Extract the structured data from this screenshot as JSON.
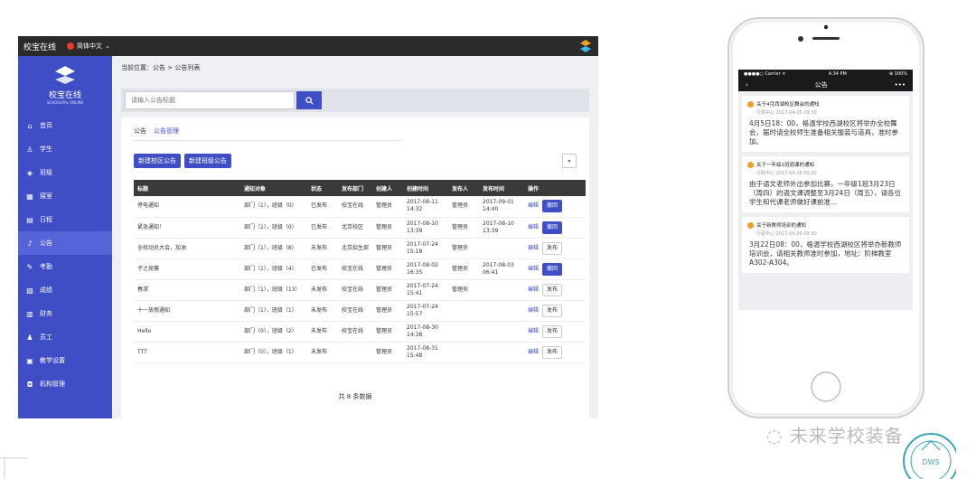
{
  "app": {
    "brand": "校宝在线",
    "language": "简体中文",
    "logo_title": "校宝在线",
    "logo_subtitle": "SCHOOLPAL ONLINE"
  },
  "sidebar": {
    "items": [
      {
        "label": "首页",
        "icon": "home-icon",
        "glyph": "⌂"
      },
      {
        "label": "学生",
        "icon": "student-icon",
        "glyph": "♙"
      },
      {
        "label": "班级",
        "icon": "class-icon",
        "glyph": "◈"
      },
      {
        "label": "寝室",
        "icon": "dorm-icon",
        "glyph": "▦"
      },
      {
        "label": "日程",
        "icon": "calendar-icon",
        "glyph": "▤"
      },
      {
        "label": "公告",
        "icon": "bell-icon",
        "glyph": "♪"
      },
      {
        "label": "考勤",
        "icon": "attendance-icon",
        "glyph": "✎"
      },
      {
        "label": "成绩",
        "icon": "score-icon",
        "glyph": "▧"
      },
      {
        "label": "财务",
        "icon": "finance-icon",
        "glyph": "▥"
      },
      {
        "label": "员工",
        "icon": "staff-icon",
        "glyph": "♟"
      },
      {
        "label": "教学设置",
        "icon": "settings-icon",
        "glyph": "▣"
      },
      {
        "label": "机构管理",
        "icon": "org-icon",
        "glyph": "◘"
      }
    ]
  },
  "breadcrumb": "当前位置：公告 > 公告列表",
  "search": {
    "placeholder": "请输入公告标题"
  },
  "tabs": [
    "公告",
    "公告管理"
  ],
  "actions": {
    "new_school": "新建校区公告",
    "new_class": "新建班级公告"
  },
  "table": {
    "headers": [
      "标题",
      "通知对象",
      "状态",
      "发布部门",
      "创建人",
      "创建时间",
      "发布人",
      "发布时间",
      "操作"
    ],
    "rows": [
      {
        "title": "停电通知",
        "target": "部门（1），班级（0）",
        "status": "已发布",
        "dept": "校宝在线",
        "creator": "管理员",
        "created": "2017-08-11 14:32",
        "publisher": "管理员",
        "published": "2017-09-01 14:40",
        "edit": "编辑",
        "action": "撤回"
      },
      {
        "title": "紧急通知！",
        "target": "部门（1），班级（0）",
        "status": "已发布",
        "dept": "北京校区",
        "creator": "管理员",
        "created": "2017-08-10 13:39",
        "publisher": "管理员",
        "published": "2017-08-10 13:39",
        "edit": "编辑",
        "action": "撤回"
      },
      {
        "title": "全校动员大会，加油",
        "target": "部门（1），班级（8）",
        "status": "未发布",
        "dept": "北京招生部",
        "creator": "管理员",
        "created": "2017-07-24 15:18",
        "publisher": "管理员",
        "published": "",
        "edit": "编辑",
        "action": "发布"
      },
      {
        "title": "子之竞赛",
        "target": "部门（1），班级（4）",
        "status": "已发布",
        "dept": "校宝在线",
        "creator": "管理员",
        "created": "2017-08-02 16:35",
        "publisher": "管理员",
        "published": "2017-08-03 06:41",
        "edit": "编辑",
        "action": "撤回"
      },
      {
        "title": "春游",
        "target": "部门（1），班级（13）",
        "status": "未发布",
        "dept": "校宝在线",
        "creator": "管理员",
        "created": "2017-07-24 15:41",
        "publisher": "管理员",
        "published": "",
        "edit": "编辑",
        "action": "发布"
      },
      {
        "title": "十一放假通知",
        "target": "部门（1），班级（1）",
        "status": "未发布",
        "dept": "校宝在线",
        "creator": "管理员",
        "created": "2017-07-24 15:57",
        "publisher": "",
        "published": "",
        "edit": "编辑",
        "action": "发布"
      },
      {
        "title": "Hello",
        "target": "部门（0），班级（2）",
        "status": "未发布",
        "dept": "校宝在线",
        "creator": "管理员",
        "created": "2017-08-30 14:38",
        "publisher": "",
        "published": "",
        "edit": "编辑",
        "action": "发布"
      },
      {
        "title": "TTT",
        "target": "部门（0），班级（1）",
        "status": "未发布",
        "dept": "",
        "creator": "管理员",
        "created": "2017-08-31 15:48",
        "publisher": "",
        "published": "",
        "edit": "编辑",
        "action": "发布"
      }
    ],
    "total": "共 8 条数据"
  },
  "phone": {
    "carrier": "●●●●○ Carrier ᯤ",
    "time": "4:34 PM",
    "battery": "⊕ 100%",
    "title": "公告",
    "back": "‹",
    "more": "•••",
    "cards": [
      {
        "title": "关于4月西湖校区舞会的通知",
        "meta": "行政中心  2017-04-26 09:30",
        "body": "4月5日18：00，格温学校西湖校区将举办全校舞会，届时请全校师生准备相关服装与道具，准时参加。"
      },
      {
        "title": "关于一年级1班调课的通知",
        "meta": "行政中心  2017-04-26 09:30",
        "body": "由于语文老师外出参加比赛，一年级1班3月23日（周四）的语文课调整至3月24日（周五），请各位学生和代课老师做好课前准..."
      },
      {
        "title": "关于新教师培训的通知",
        "meta": "行政中心  2017-04-26 09:30",
        "body": "3月22日08：00，格温学校西湖校区将举办新教师培训会，请相关教师准时参加，地址：阶梯教室A302-A304。"
      }
    ]
  },
  "watermark": {
    "text": "未来学校装备",
    "seal_text": "DWS"
  },
  "colors": {
    "accent": "#3f4ec4",
    "topbar": "#2b2b2b",
    "card_dot": "#f39c26"
  }
}
